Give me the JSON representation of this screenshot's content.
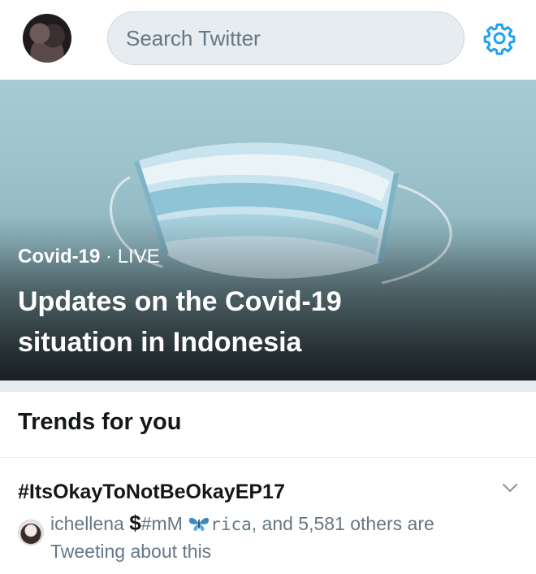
{
  "header": {
    "avatar_icon": "profile-avatar",
    "search_placeholder": "Search Twitter",
    "settings_icon": "gear-icon"
  },
  "hero": {
    "category": "Covid-19",
    "separator": "·",
    "status": "LIVE",
    "headline": "Updates on the Covid-19 situation in Indonesia",
    "image_icon": "surgical-mask-image"
  },
  "trends": {
    "section_title": "Trends for you",
    "items": [
      {
        "hashtag": "#ItsOkayToNotBeOkayEP17",
        "user1": "ichellena",
        "user1_emoji": "$",
        "user1_tag": "#mM",
        "user1_emoji2_icon": "butterfly-icon",
        "user2": "rica",
        "others_text": ", and 5,581 others are Tweeting about this",
        "caret_icon": "chevron-down-icon"
      }
    ]
  },
  "colors": {
    "accent": "#1da1f2",
    "text_primary": "#14171a",
    "text_secondary": "#657786",
    "search_bg": "#e6ecf0"
  }
}
